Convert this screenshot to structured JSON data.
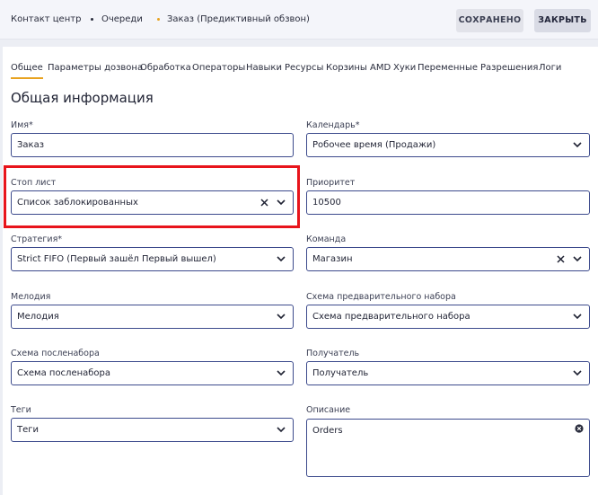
{
  "breadcrumb": {
    "items": [
      "Контакт центр",
      "Очереди",
      "Заказ (Предиктивный обзвон)"
    ]
  },
  "toolbar": {
    "saved_label": "СОХРАНЕНО",
    "close_label": "ЗАКРЫТЬ"
  },
  "colors": {
    "accent": "#e8a21f",
    "field_border": "#3c4a8c",
    "highlight": "#e8141b"
  },
  "tabs": [
    "Общее",
    "Параметры дозвона",
    "Обработка",
    "Операторы",
    "Навыки",
    "Ресурсы",
    "Корзины AMD",
    "Хуки",
    "Переменные",
    "Разрешения",
    "Логи"
  ],
  "active_tab": "Общее",
  "section": {
    "title": "Общая информация"
  },
  "form": {
    "name": {
      "label": "Имя*",
      "value": "Заказ"
    },
    "calendar": {
      "label": "Календарь*",
      "value": "Робочее время (Продажи)"
    },
    "stoplist": {
      "label": "Стоп лист",
      "value": "Список заблокированных"
    },
    "priority": {
      "label": "Приоритет",
      "value": "10500"
    },
    "strategy": {
      "label": "Стратегия*",
      "value": "Strict FIFO (Первый зашёл Первый вышел)"
    },
    "team": {
      "label": "Команда",
      "value": "Магазин"
    },
    "melody": {
      "label": "Мелодия",
      "value": "Мелодия"
    },
    "predial": {
      "label": "Схема предварительного набора",
      "value": "Схема предварительного набора"
    },
    "postdial": {
      "label": "Схема посленабора",
      "value": "Схема посленабора"
    },
    "recipient": {
      "label": "Получатель",
      "value": "Получатель"
    },
    "tags": {
      "label": "Теги",
      "value": "Теги"
    },
    "description": {
      "label": "Описание",
      "value": "Orders"
    }
  }
}
